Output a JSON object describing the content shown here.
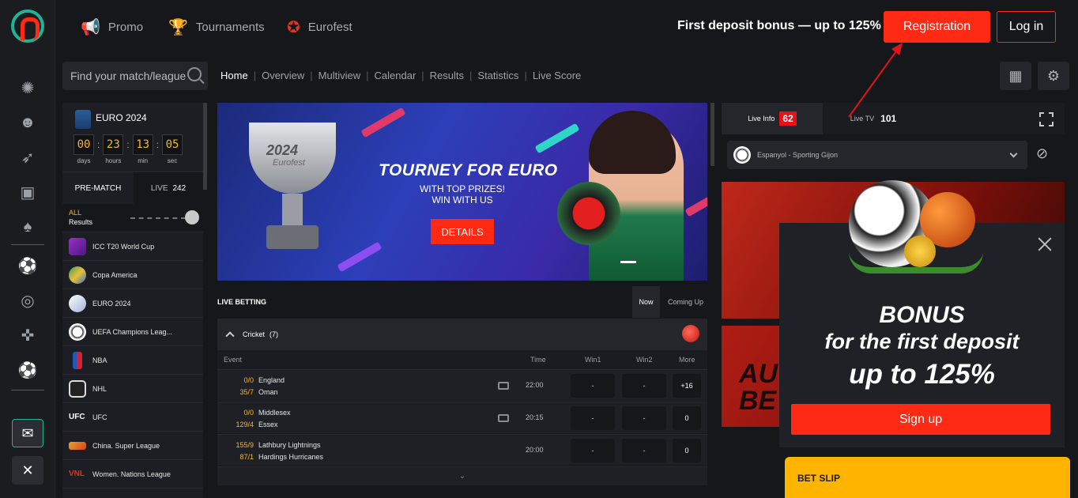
{
  "rail": {
    "icons": [
      "casino-chip-icon",
      "user-icon",
      "rocket-icon",
      "tv-icon",
      "cards-icon",
      "football-icon",
      "target-icon",
      "gamepad-icon",
      "soccer-ball-icon",
      "chat-icon",
      "flag-uk-icon"
    ]
  },
  "topnav": {
    "promo": "Promo",
    "tournaments": "Tournaments",
    "eurofest": "Eurofest",
    "bonus_text": "First deposit bonus — up to 125%",
    "registration": "Registration",
    "login": "Log in"
  },
  "search": {
    "placeholder": "Find your match/league"
  },
  "subnav": [
    "Home",
    "Overview",
    "Multiview",
    "Calendar",
    "Results",
    "Statistics",
    "Live Score"
  ],
  "sidebar": {
    "euro_title": "EURO 2024",
    "countdown": [
      {
        "value": "00",
        "label": "days"
      },
      {
        "value": "23",
        "label": "hours"
      },
      {
        "value": "13",
        "label": "min"
      },
      {
        "value": "05",
        "label": "sec"
      }
    ],
    "tab_prematch": "PRE-MATCH",
    "tab_live": "LIVE",
    "live_count": "242",
    "all_label": "ALL",
    "results_label": "Results",
    "leagues": [
      {
        "name": "ICC T20 World Cup",
        "icon": "purple"
      },
      {
        "name": "Copa America",
        "icon": "flag"
      },
      {
        "name": "EURO 2024",
        "icon": "euro"
      },
      {
        "name": "UEFA Champions Leag...",
        "icon": "ball"
      },
      {
        "name": "NBA",
        "icon": "nba"
      },
      {
        "name": "NHL",
        "icon": "nhl"
      },
      {
        "name": "UFC",
        "icon": "ufc"
      },
      {
        "name": "China. Super League",
        "icon": "cn"
      },
      {
        "name": "Women. Nations League",
        "icon": "vnl"
      }
    ]
  },
  "banner": {
    "cup_text": "2024",
    "cup_subtext": "Eurofest",
    "title": "TOURNEY FOR EURO",
    "subtitle_1": "WITH TOP PRIZES!",
    "subtitle_2": "WIN WITH US",
    "button": "DETAILS"
  },
  "live_betting": {
    "title": "LIVE BETTING",
    "tab_now": "Now",
    "tab_coming": "Coming Up",
    "sport": "Cricket",
    "sport_count": "(7)",
    "columns": {
      "event": "Event",
      "time": "Time",
      "win1": "Win1",
      "win2": "Win2",
      "more": "More"
    },
    "events": [
      {
        "score1": "0/0",
        "team1": "England",
        "score2": "35/7",
        "team2": "Oman",
        "tv": true,
        "time": "22:00",
        "win1": "-",
        "win2": "-",
        "more": "+16"
      },
      {
        "score1": "0/0",
        "team1": "Middlesex",
        "score2": "129/4",
        "team2": "Essex",
        "tv": true,
        "time": "20:15",
        "win1": "-",
        "win2": "-",
        "more": "0"
      },
      {
        "score1": "155/9",
        "team1": "Lathbury Lightnings",
        "score2": "87/1",
        "team2": "Hardings Hurricanes",
        "tv": false,
        "time": "20:00",
        "win1": "-",
        "win2": "-",
        "more": "0"
      }
    ]
  },
  "right_panel": {
    "tab_live_info": "Live Info",
    "live_info_count": "62",
    "tab_live_tv": "Live TV",
    "live_tv_count": "101",
    "match": "Espanyol - Sporting Gijon"
  },
  "popup": {
    "line1": "BONUS",
    "line2": "for the first deposit",
    "line3": "up to 125%",
    "signup": "Sign up"
  },
  "promo2_text": "AU\nBE",
  "betslip": "BET SLIP",
  "colors": {
    "accent": "#ff2a13",
    "gold": "#f3b62d",
    "betslip": "#ffb400"
  }
}
